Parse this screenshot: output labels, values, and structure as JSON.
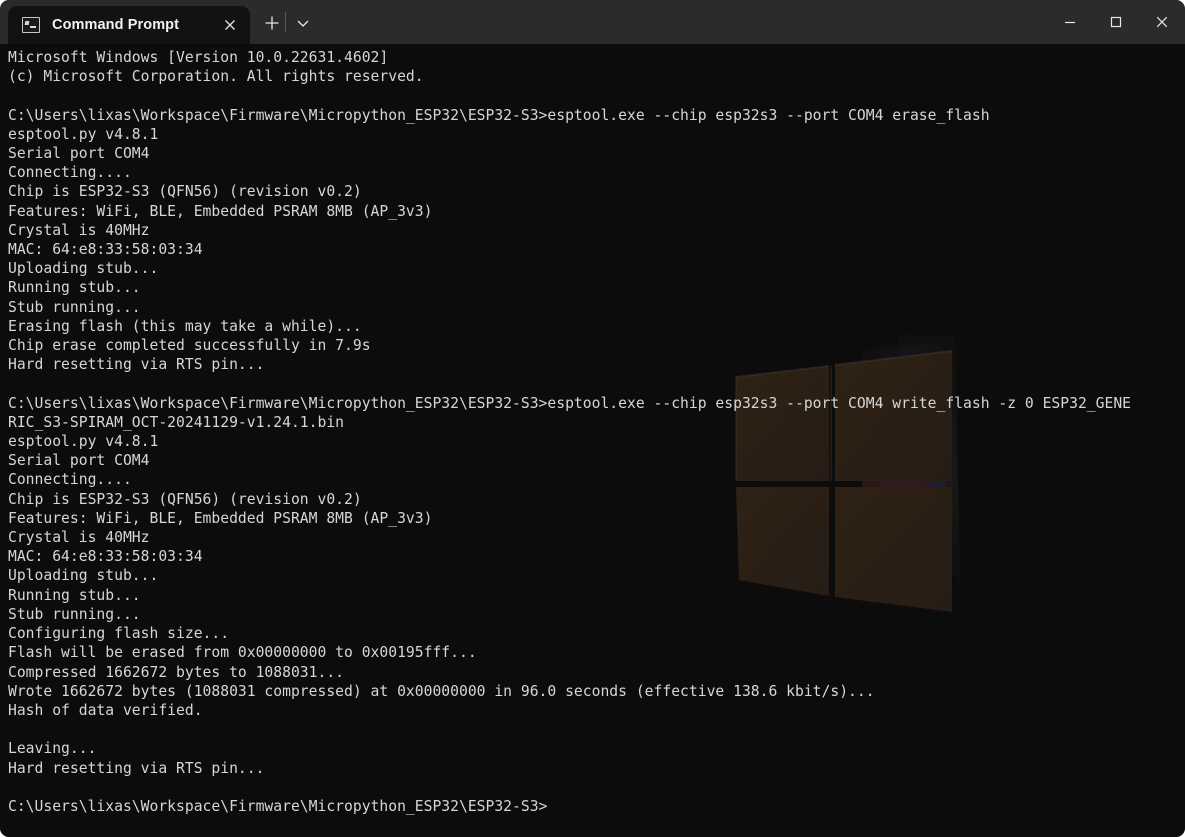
{
  "window": {
    "title": "Command Prompt",
    "controls": {
      "minimize_label": "Minimize",
      "maximize_label": "Maximize",
      "close_label": "Close"
    }
  },
  "tabbar": {
    "active_tab": {
      "icon": "console-icon",
      "label": "Command Prompt",
      "close_label": "Close tab"
    },
    "new_tab_label": "New tab",
    "tab_menu_label": "Open new tab dropdown"
  },
  "colors": {
    "titlebar_bg": "#2b2b2b",
    "tab_bg": "#121212",
    "terminal_bg": "#0c0c0c",
    "terminal_fg": "#d6d6d6",
    "wallpaper_pane": "#7a4f26",
    "wallpaper_ribbon_red": "#9c3b4a",
    "wallpaper_ribbon_blue": "#4a4a9c"
  },
  "terminal": {
    "prompt_path": "C:\\Users\\lixas\\Workspace\\Firmware\\Micropython_ESP32\\ESP32-S3>",
    "commands": [
      "esptool.exe --chip esp32s3 --port COM4 erase_flash",
      "esptool.exe --chip esp32s3 --port COM4 write_flash -z 0 ESP32_GENERIC_S3-SPIRAM_OCT-20241129-v1.24.1.bin"
    ],
    "lines": [
      "Microsoft Windows [Version 10.0.22631.4602]",
      "(c) Microsoft Corporation. All rights reserved.",
      "",
      "C:\\Users\\lixas\\Workspace\\Firmware\\Micropython_ESP32\\ESP32-S3>esptool.exe --chip esp32s3 --port COM4 erase_flash",
      "esptool.py v4.8.1",
      "Serial port COM4",
      "Connecting....",
      "Chip is ESP32-S3 (QFN56) (revision v0.2)",
      "Features: WiFi, BLE, Embedded PSRAM 8MB (AP_3v3)",
      "Crystal is 40MHz",
      "MAC: 64:e8:33:58:03:34",
      "Uploading stub...",
      "Running stub...",
      "Stub running...",
      "Erasing flash (this may take a while)...",
      "Chip erase completed successfully in 7.9s",
      "Hard resetting via RTS pin...",
      "",
      "C:\\Users\\lixas\\Workspace\\Firmware\\Micropython_ESP32\\ESP32-S3>esptool.exe --chip esp32s3 --port COM4 write_flash -z 0 ESP32_GENE",
      "RIC_S3-SPIRAM_OCT-20241129-v1.24.1.bin",
      "esptool.py v4.8.1",
      "Serial port COM4",
      "Connecting....",
      "Chip is ESP32-S3 (QFN56) (revision v0.2)",
      "Features: WiFi, BLE, Embedded PSRAM 8MB (AP_3v3)",
      "Crystal is 40MHz",
      "MAC: 64:e8:33:58:03:34",
      "Uploading stub...",
      "Running stub...",
      "Stub running...",
      "Configuring flash size...",
      "Flash will be erased from 0x00000000 to 0x00195fff...",
      "Compressed 1662672 bytes to 1088031...",
      "Wrote 1662672 bytes (1088031 compressed) at 0x00000000 in 96.0 seconds (effective 138.6 kbit/s)...",
      "Hash of data verified.",
      "",
      "Leaving...",
      "Hard resetting via RTS pin...",
      "",
      "C:\\Users\\lixas\\Workspace\\Firmware\\Micropython_ESP32\\ESP32-S3>"
    ]
  }
}
